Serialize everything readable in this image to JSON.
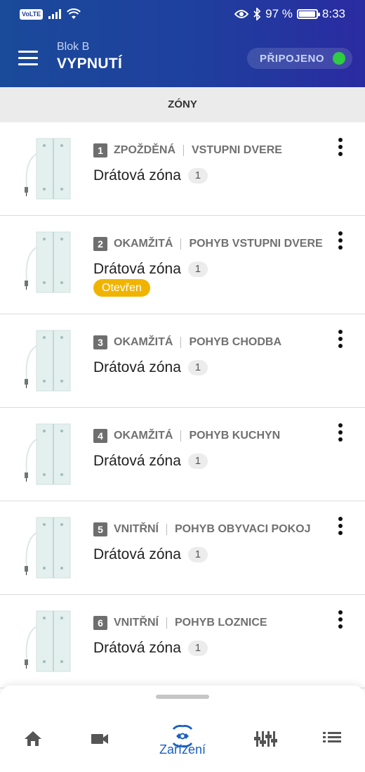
{
  "status_bar": {
    "carrier_badge": "VoLTE",
    "battery_percent": "97 %",
    "battery_level": 0.97,
    "time": "8:33",
    "icons": [
      "signal-icon",
      "wifi-icon",
      "eye-icon",
      "bluetooth-icon",
      "battery-icon"
    ]
  },
  "header": {
    "subtitle": "Blok B",
    "title": "VYPNUTÍ",
    "connection_label": "PŘIPOJENO",
    "connection_color": "#2ecc40",
    "menu_icon": "menu-icon"
  },
  "section": {
    "title": "ZÓNY"
  },
  "zones": [
    {
      "number": "1",
      "type": "ZPOŽDĚNÁ",
      "name": "VSTUPNI DVERE",
      "device": "Drátová zóna",
      "count": "1",
      "status": ""
    },
    {
      "number": "2",
      "type": "OKAMŽITÁ",
      "name": "POHYB VSTUPNI DVERE",
      "device": "Drátová zóna",
      "count": "1",
      "status": "Otevřen"
    },
    {
      "number": "3",
      "type": "OKAMŽITÁ",
      "name": "POHYB CHODBA",
      "device": "Drátová zóna",
      "count": "1",
      "status": ""
    },
    {
      "number": "4",
      "type": "OKAMŽITÁ",
      "name": "POHYB KUCHYN",
      "device": "Drátová zóna",
      "count": "1",
      "status": ""
    },
    {
      "number": "5",
      "type": "VNITŘNÍ",
      "name": "POHYB OBYVACI POKOJ",
      "device": "Drátová zóna",
      "count": "1",
      "status": ""
    },
    {
      "number": "6",
      "type": "VNITŘNÍ",
      "name": "POHYB LOZNICE",
      "device": "Drátová zóna",
      "count": "1",
      "status": ""
    }
  ],
  "colors": {
    "header_gradient": [
      "#1a4a9a",
      "#2a2ba0"
    ],
    "accent": "#1c5fc0",
    "status_open": "#f0b400"
  },
  "bottom_nav": {
    "items": [
      {
        "icon": "home-icon",
        "label": ""
      },
      {
        "icon": "camera-icon",
        "label": ""
      },
      {
        "icon": "devices-icon",
        "label": "Zařízení",
        "active": true
      },
      {
        "icon": "mixer-icon",
        "label": ""
      },
      {
        "icon": "list-icon",
        "label": ""
      }
    ]
  }
}
